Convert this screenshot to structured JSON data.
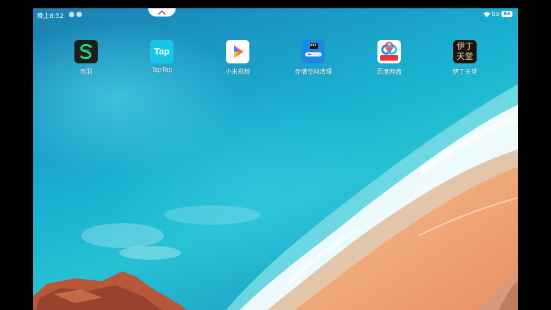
{
  "status_bar": {
    "time": "晚上8:52",
    "network_label": "bo",
    "battery_level": "84"
  },
  "apps": [
    {
      "label": "电羽",
      "icon": "dianyu-app-icon"
    },
    {
      "label": "TapTap",
      "icon_text": "Tap",
      "icon": "taptap-app-icon"
    },
    {
      "label": "小米视频",
      "icon": "mi-video-app-icon"
    },
    {
      "label": "存储空间清理",
      "icon": "storage-cleaner-app-icon"
    },
    {
      "label": "百度网盘",
      "icon_text": "百度网盘",
      "icon": "baidu-netdisk-app-icon"
    },
    {
      "label": "伊丁天堂",
      "icon_text": "伊丁天堂",
      "icon": "yiding-tiantang-app-icon"
    }
  ],
  "colors": {
    "accent_taptap": "#17c6e6",
    "accent_storage": "#1e88e5",
    "sea": "#1ab3d1",
    "sand": "#f0a878"
  }
}
